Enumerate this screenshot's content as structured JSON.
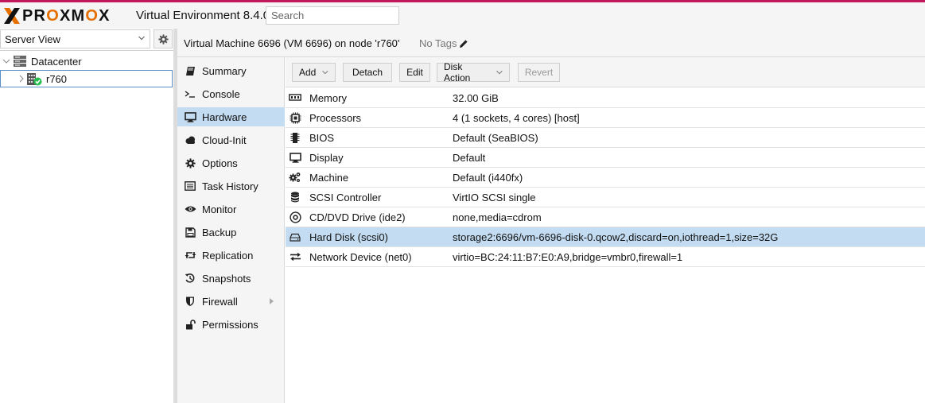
{
  "app": {
    "brand_main": "PR",
    "brand_o1": "O",
    "brand_mid": "XM",
    "brand_o2": "O",
    "brand_end": "X",
    "product": "Virtual Environment 8.4.0",
    "search_placeholder": "Search",
    "accent_color": "#e57000",
    "topbar_stripe_color": "#c2185b"
  },
  "tree": {
    "view_selector": "Server View",
    "gear_icon": "gear-icon",
    "nodes": [
      {
        "label": "Datacenter",
        "icon": "datacenter-icon"
      },
      {
        "label": "r760",
        "icon": "server-online-icon"
      }
    ]
  },
  "header": {
    "title": "Virtual Machine 6696 (VM 6696) on node 'r760'",
    "tags": "No Tags"
  },
  "vm_nav": {
    "items": [
      {
        "label": "Summary",
        "icon": "book-icon"
      },
      {
        "label": "Console",
        "icon": "terminal-icon"
      },
      {
        "label": "Hardware",
        "icon": "desktop-icon",
        "active": true
      },
      {
        "label": "Cloud-Init",
        "icon": "cloud-icon"
      },
      {
        "label": "Options",
        "icon": "gear-icon"
      },
      {
        "label": "Task History",
        "icon": "list-icon"
      },
      {
        "label": "Monitor",
        "icon": "eye-icon"
      },
      {
        "label": "Backup",
        "icon": "floppy-icon"
      },
      {
        "label": "Replication",
        "icon": "retweet-icon"
      },
      {
        "label": "Snapshots",
        "icon": "history-icon"
      },
      {
        "label": "Firewall",
        "icon": "shield-icon"
      },
      {
        "label": "Permissions",
        "icon": "unlock-icon"
      }
    ]
  },
  "toolbar": {
    "add": "Add",
    "detach": "Detach",
    "edit": "Edit",
    "disk_action": "Disk Action",
    "revert": "Revert"
  },
  "hardware": {
    "rows": [
      {
        "key": "Memory",
        "value": "32.00 GiB",
        "icon": "memory-icon"
      },
      {
        "key": "Processors",
        "value": "4 (1 sockets, 4 cores) [host]",
        "icon": "cpu-icon"
      },
      {
        "key": "BIOS",
        "value": "Default (SeaBIOS)",
        "icon": "microchip-icon"
      },
      {
        "key": "Display",
        "value": "Default",
        "icon": "desktop-icon"
      },
      {
        "key": "Machine",
        "value": "Default (i440fx)",
        "icon": "cogs-icon"
      },
      {
        "key": "SCSI Controller",
        "value": "VirtIO SCSI single",
        "icon": "database-icon"
      },
      {
        "key": "CD/DVD Drive (ide2)",
        "value": "none,media=cdrom",
        "icon": "cdrom-icon"
      },
      {
        "key": "Hard Disk (scsi0)",
        "value": "storage2:6696/vm-6696-disk-0.qcow2,discard=on,iothread=1,size=32G",
        "icon": "hdd-icon",
        "selected": true
      },
      {
        "key": "Network Device (net0)",
        "value": "virtio=BC:24:11:B7:E0:A9,bridge=vmbr0,firewall=1",
        "icon": "exchange-icon"
      }
    ]
  }
}
